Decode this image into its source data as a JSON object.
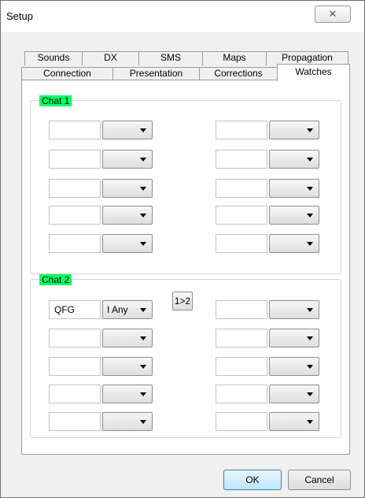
{
  "window": {
    "title": "Setup",
    "close_glyph": "✕"
  },
  "tabs": {
    "row1": [
      "Sounds",
      "DX",
      "SMS",
      "Maps",
      "Propagation"
    ],
    "row2": [
      "Connection",
      "Presentation",
      "Corrections",
      "Watches"
    ],
    "active": "Watches"
  },
  "chat1": {
    "label": "Chat 1",
    "left": [
      {
        "text": "",
        "select": ""
      },
      {
        "text": "",
        "select": ""
      },
      {
        "text": "",
        "select": ""
      },
      {
        "text": "",
        "select": ""
      },
      {
        "text": "",
        "select": ""
      }
    ],
    "right": [
      {
        "text": "",
        "select": ""
      },
      {
        "text": "",
        "select": ""
      },
      {
        "text": "",
        "select": ""
      },
      {
        "text": "",
        "select": ""
      },
      {
        "text": "",
        "select": ""
      }
    ]
  },
  "chat2": {
    "label": "Chat 2",
    "copy_button": "1>2",
    "left": [
      {
        "text": "QFG",
        "select": "I Any"
      },
      {
        "text": "",
        "select": ""
      },
      {
        "text": "",
        "select": ""
      },
      {
        "text": "",
        "select": ""
      },
      {
        "text": "",
        "select": ""
      }
    ],
    "right": [
      {
        "text": "",
        "select": ""
      },
      {
        "text": "",
        "select": ""
      },
      {
        "text": "",
        "select": ""
      },
      {
        "text": "",
        "select": ""
      },
      {
        "text": "",
        "select": ""
      }
    ]
  },
  "footer": {
    "ok": "OK",
    "cancel": "Cancel"
  },
  "colors": {
    "group_label_bg": "#00ff66",
    "default_button": "#bee6fd"
  }
}
